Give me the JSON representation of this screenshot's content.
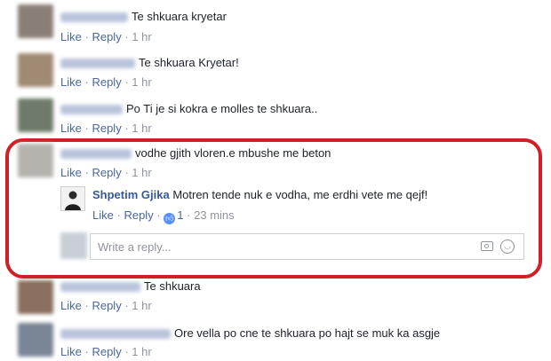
{
  "actions": {
    "like": "Like",
    "reply": "Reply",
    "separator": "·"
  },
  "comments": [
    {
      "text": "Te shkuara kryetar",
      "time": "1 hr"
    },
    {
      "text": "Te shkuara Kryetar!",
      "time": "1 hr"
    },
    {
      "text": "Po Ti je si kokra e molles te shkuara..",
      "time": "1 hr"
    },
    {
      "text": "vodhe gjith vloren.e mbushe me beton",
      "time": "1 hr"
    },
    {
      "text": "Te shkuara",
      "time": "1 hr"
    },
    {
      "text": "Ore vella po cne te shkuara po hajt se muk ka asgje",
      "time": "1 hr"
    }
  ],
  "reply": {
    "author": "Shpetim Gjika",
    "text": "Motren tende nuk e vodha, me erdhi vete me qejf!",
    "like_count": "1",
    "time": "23 mins"
  },
  "composer": {
    "placeholder": "Write a reply...",
    "camera_icon": "camera-icon",
    "emoji_icon": "smiley-icon"
  },
  "colors": {
    "link": "#4b67a1",
    "name": "#365899",
    "highlight": "#d21f26",
    "like_badge": "#5890ff"
  }
}
